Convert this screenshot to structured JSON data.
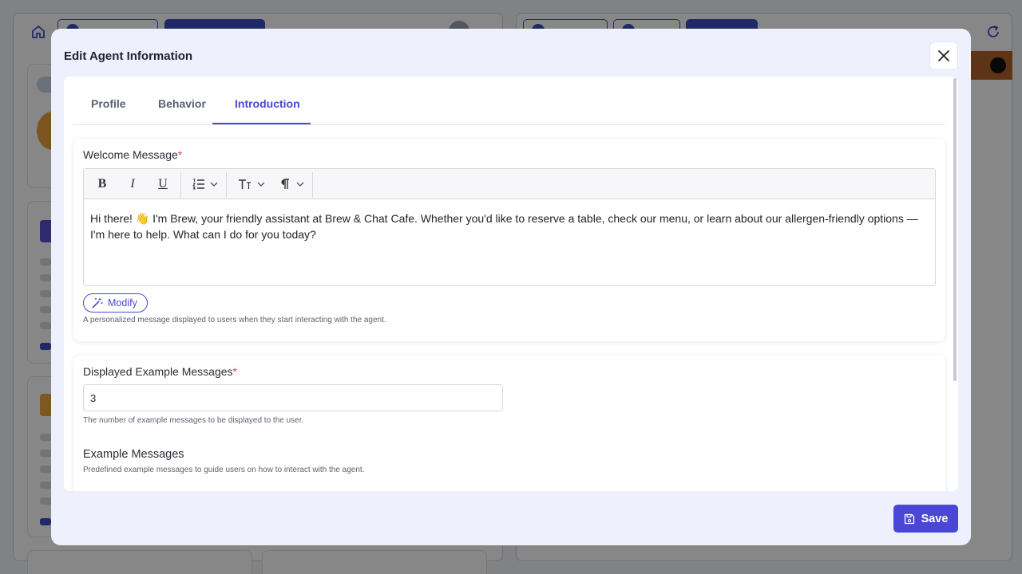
{
  "modal": {
    "title": "Edit Agent Information",
    "save_label": "Save"
  },
  "tabs": [
    {
      "label": "Profile",
      "active": false
    },
    {
      "label": "Behavior",
      "active": false
    },
    {
      "label": "Introduction",
      "active": true
    }
  ],
  "welcome": {
    "label": "Welcome Message",
    "required_mark": "*",
    "text": "Hi there! 👋 I'm Brew, your friendly assistant at Brew & Chat Cafe. Whether you'd like to reserve a table, check our menu, or learn about our allergen-friendly options — I'm here to help. What can I do for you today?",
    "modify_label": "Modify",
    "help": "A personalized message displayed to users when they start interacting with the agent.",
    "toolbar": {
      "bold": "B",
      "italic": "I",
      "underline": "U",
      "list_icon": "ordered-list-icon",
      "text_size_icon": "text-size-icon",
      "paragraph_icon": "paragraph-icon"
    }
  },
  "example_count": {
    "label": "Displayed Example Messages",
    "required_mark": "*",
    "value": "3",
    "help": "The number of example messages to be displayed to the user."
  },
  "examples": {
    "title": "Example Messages",
    "help": "Predefined example messages to guide users on how to interact with the agent."
  },
  "colors": {
    "accent": "#4a47d6",
    "required": "#e04848",
    "modal_bg": "#eef1fd"
  }
}
